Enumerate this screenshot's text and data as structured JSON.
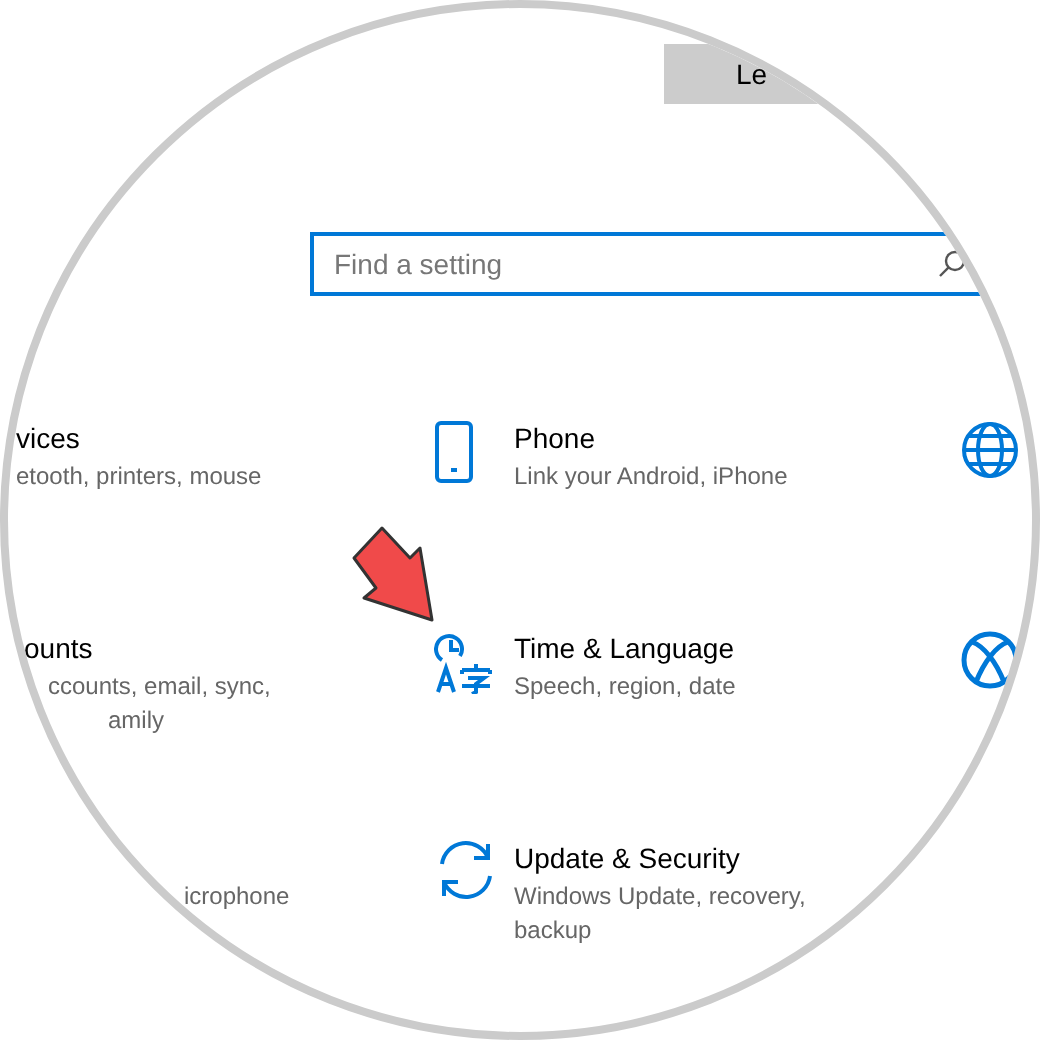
{
  "top_button": {
    "label": "Le"
  },
  "search": {
    "placeholder": "Find a setting"
  },
  "settings_grid": [
    {
      "left": {
        "title": "vices",
        "description": [
          "etooth, printers, mouse"
        ]
      },
      "middle": {
        "title": "Phone",
        "description": [
          "Link your Android, iPhone"
        ]
      }
    },
    {
      "left": {
        "title": "ounts",
        "description": [
          "ccounts, email, sync,",
          "amily"
        ]
      },
      "middle": {
        "title": "Time & Language",
        "description": [
          "Speech, region, date"
        ]
      }
    },
    {
      "left": {
        "description": [
          "icrophone"
        ]
      },
      "middle": {
        "title": "Update & Security",
        "description": [
          "Windows Update, recovery,",
          "backup"
        ]
      }
    }
  ]
}
